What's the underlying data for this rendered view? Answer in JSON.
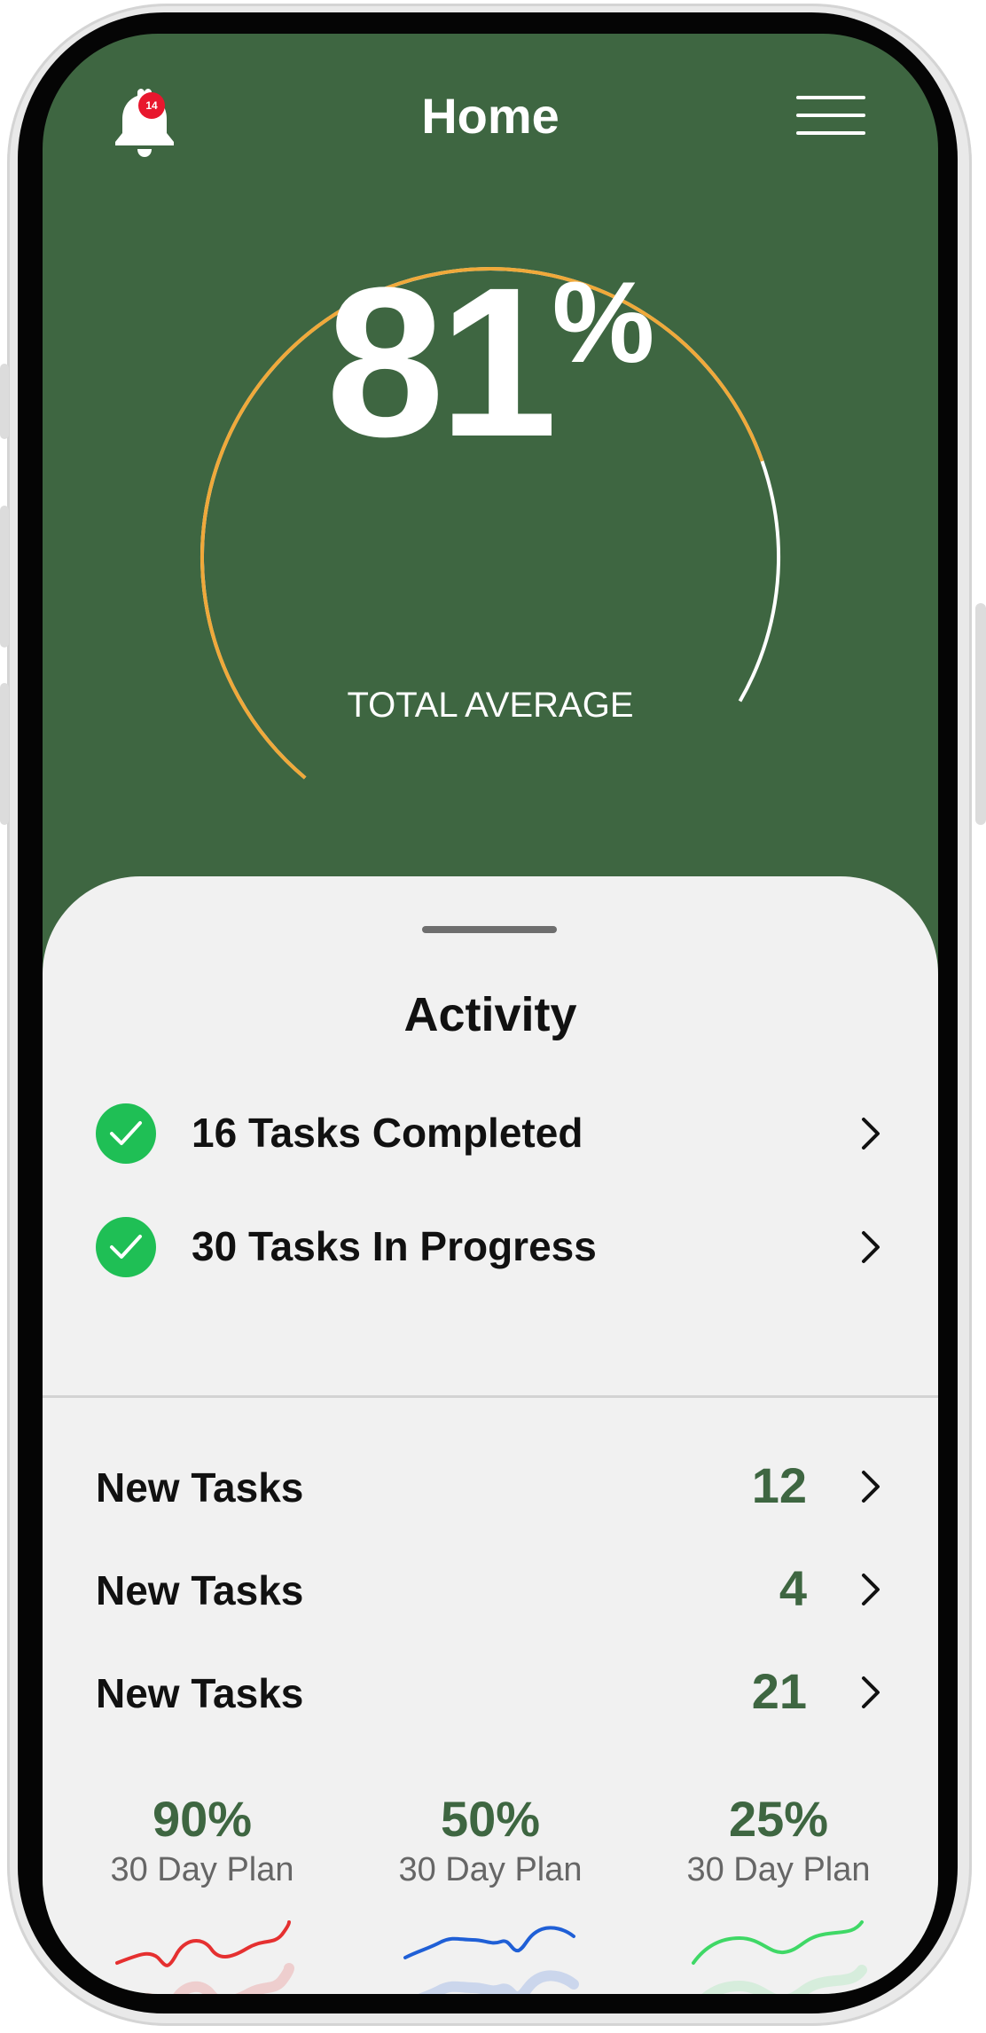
{
  "header": {
    "title": "Home",
    "notification_count": "14"
  },
  "gauge": {
    "value": "81",
    "unit": "%",
    "label": "TOTAL AVERAGE",
    "progress": 0.81,
    "arc_color": "#f0a93a"
  },
  "colors": {
    "primary_green": "#3e6641",
    "check_green": "#1fbf55",
    "badge_red": "#e8172e"
  },
  "activity": {
    "title": "Activity",
    "items": [
      {
        "label": "16 Tasks Completed"
      },
      {
        "label": "30 Tasks In Progress"
      }
    ]
  },
  "tasks": [
    {
      "label": "New Tasks",
      "count": "12"
    },
    {
      "label": "New Tasks",
      "count": "4"
    },
    {
      "label": "New Tasks",
      "count": "21"
    }
  ],
  "plans": [
    {
      "percent": "90%",
      "label": "30 Day Plan",
      "color": "#e53030"
    },
    {
      "percent": "50%",
      "label": "30 Day Plan",
      "color": "#1f5fd6"
    },
    {
      "percent": "25%",
      "label": "30 Day Plan",
      "color": "#3fd866"
    }
  ]
}
